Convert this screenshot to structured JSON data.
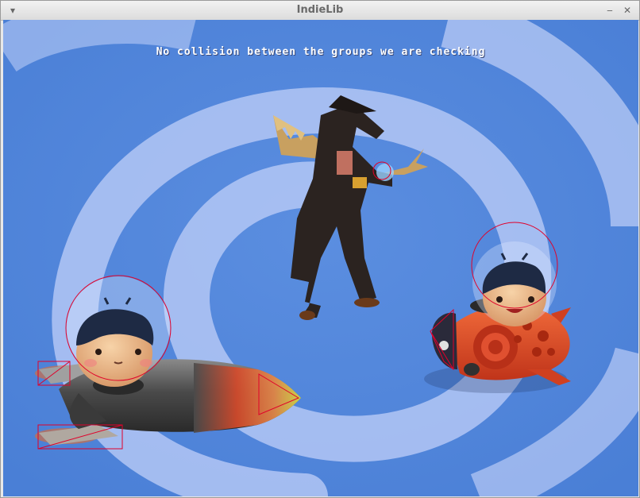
{
  "window": {
    "title": "IndieLib",
    "menu_icon": "chevron-down-icon",
    "minimize_icon": "minimize-icon",
    "close_icon": "close-icon"
  },
  "game": {
    "message": "No collision between the groups we are checking",
    "background": {
      "base_color": "#4f84d8",
      "swirl_color": "#c7d6ff"
    },
    "collision_outline_color": "#e0002a"
  }
}
